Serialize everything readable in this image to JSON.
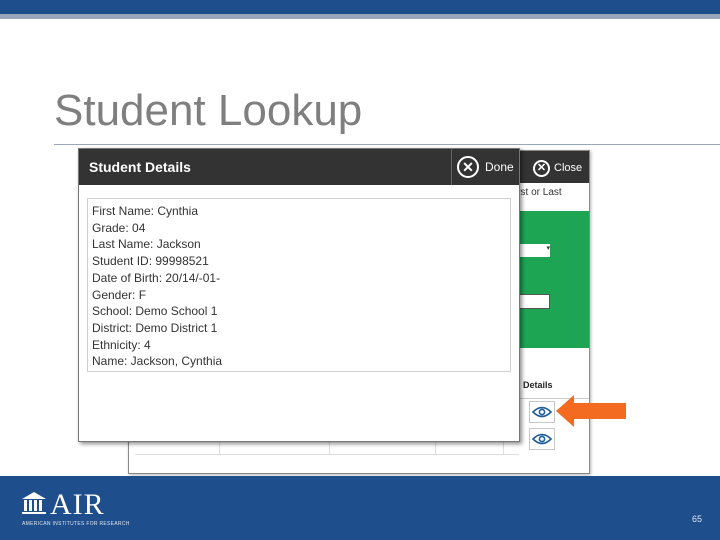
{
  "slide": {
    "title": "Student Lookup",
    "page_number": "65"
  },
  "background_window": {
    "close_label": "Close",
    "search_hint": "irst or Last",
    "details_column_header": "Details"
  },
  "modal": {
    "title": "Student Details",
    "done_label": "Done",
    "fields": [
      "First Name: Cynthia",
      "Grade: 04",
      "Last Name: Jackson",
      "Student ID: 99998521",
      "Date of Birth: 20/14/-01-",
      "Gender: F",
      "School: Demo School 1",
      "District: Demo District 1",
      "Ethnicity: 4",
      "Name: Jackson, Cynthia"
    ]
  },
  "footer": {
    "logo_text": "AIR",
    "logo_subtext": "AMERICAN INSTITUTES FOR RESEARCH"
  },
  "colors": {
    "header_bar": "#1f4e8c",
    "dark_header": "#333333",
    "green_panel": "#1ea553",
    "arrow": "#f26b21"
  }
}
